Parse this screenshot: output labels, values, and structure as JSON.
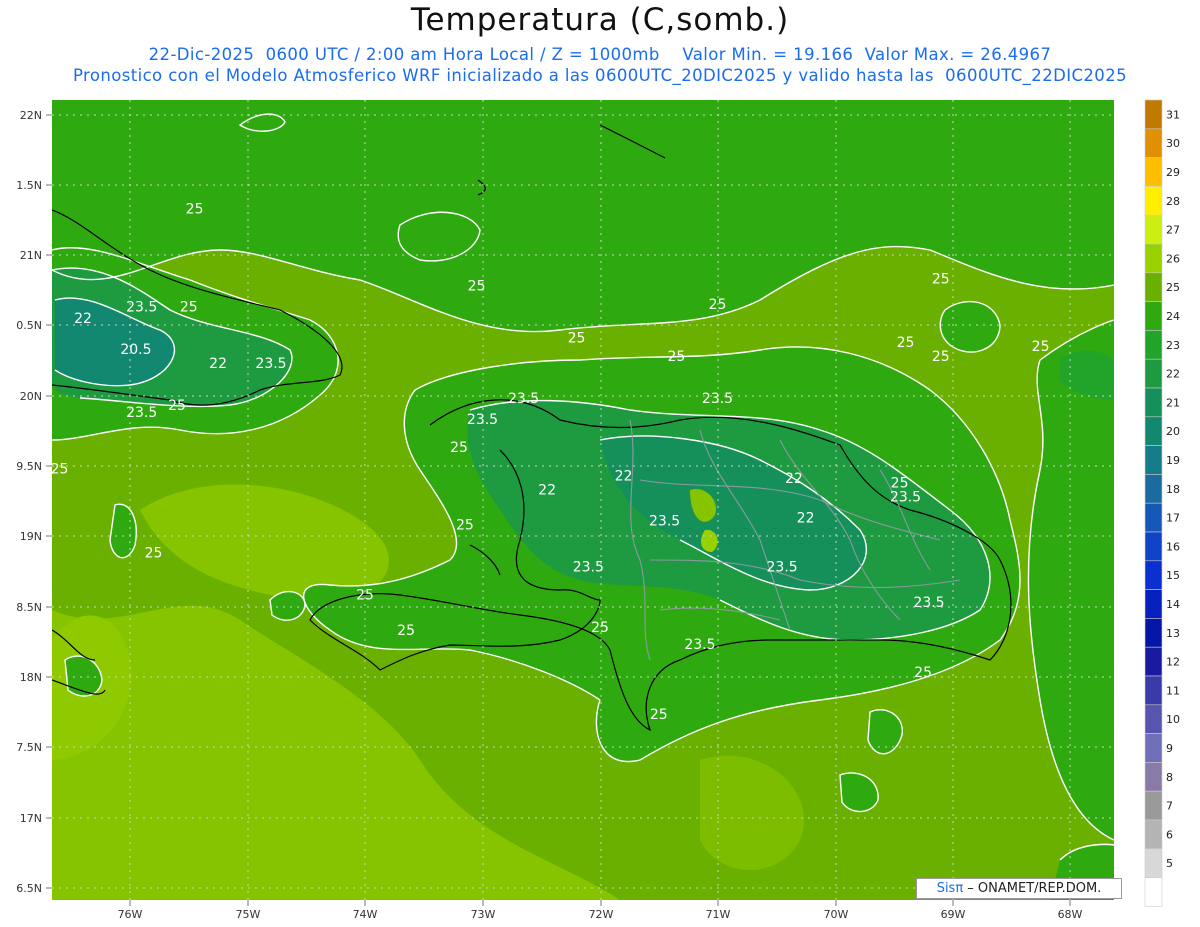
{
  "header": {
    "title": "Temperatura (C,somb.)",
    "line1": "22-Dic-2025  0600 UTC / 2:00 am Hora Local / Z = 1000mb    Valor Min. = 19.166  Valor Max. = 26.4967",
    "line2": "Pronostico con el Modelo Atmosferico WRF inicializado a las 0600UTC_20DIC2025 y valido hasta las  0600UTC_22DIC2025"
  },
  "axes": {
    "lat_labels": [
      "22N",
      "1.5N",
      "21N",
      "0.5N",
      "20N",
      "9.5N",
      "19N",
      "8.5N",
      "18N",
      "7.5N",
      "17N",
      "6.5N"
    ],
    "lon_labels": [
      "76W",
      "75W",
      "74W",
      "73W",
      "72W",
      "71W",
      "70W",
      "69W",
      "68W"
    ]
  },
  "colorbar": {
    "levels": [
      {
        "label": "31",
        "color": "#c07a00"
      },
      {
        "label": "30",
        "color": "#e09000"
      },
      {
        "label": "29",
        "color": "#ffbf00"
      },
      {
        "label": "28",
        "color": "#ffee00"
      },
      {
        "label": "27",
        "color": "#ccee10"
      },
      {
        "label": "26",
        "color": "#99d100"
      },
      {
        "label": "25",
        "color": "#6ab000"
      },
      {
        "label": "24",
        "color": "#2eaa10"
      },
      {
        "label": "23",
        "color": "#22a32a"
      },
      {
        "label": "22",
        "color": "#1e9a40"
      },
      {
        "label": "21",
        "color": "#16905a"
      },
      {
        "label": "20",
        "color": "#138870"
      },
      {
        "label": "19",
        "color": "#157c88"
      },
      {
        "label": "18",
        "color": "#1a6ca0"
      },
      {
        "label": "17",
        "color": "#1558b8"
      },
      {
        "label": "16",
        "color": "#0f44c8"
      },
      {
        "label": "15",
        "color": "#0a30d0"
      },
      {
        "label": "14",
        "color": "#0620c0"
      },
      {
        "label": "13",
        "color": "#0515a8"
      },
      {
        "label": "12",
        "color": "#1a1aa0"
      },
      {
        "label": "11",
        "color": "#3a3aa8"
      },
      {
        "label": "10",
        "color": "#5656b0"
      },
      {
        "label": "9",
        "color": "#7070b8"
      },
      {
        "label": "8",
        "color": "#8a7aa8"
      },
      {
        "label": "7",
        "color": "#9a9a9a"
      },
      {
        "label": "6",
        "color": "#b4b4b4"
      },
      {
        "label": "5",
        "color": "#d8d8d8"
      },
      {
        "label": "",
        "color": "#ffffff"
      }
    ]
  },
  "contour_labels": [
    {
      "text": "25",
      "lon": -75.45,
      "lat": 21.3
    },
    {
      "text": "25",
      "lon": -73.05,
      "lat": 20.75
    },
    {
      "text": "25",
      "lon": -71.0,
      "lat": 20.62
    },
    {
      "text": "25",
      "lon": -69.1,
      "lat": 20.8
    },
    {
      "text": "25",
      "lon": -69.1,
      "lat": 20.25
    },
    {
      "text": "25",
      "lon": -68.25,
      "lat": 20.32
    },
    {
      "text": "25",
      "lon": -69.4,
      "lat": 20.35
    },
    {
      "text": "25",
      "lon": -72.2,
      "lat": 20.38
    },
    {
      "text": "25",
      "lon": -71.35,
      "lat": 20.25
    },
    {
      "text": "25",
      "lon": -75.5,
      "lat": 20.6
    },
    {
      "text": "25",
      "lon": -75.6,
      "lat": 19.9
    },
    {
      "text": "25",
      "lon": -76.6,
      "lat": 19.45
    },
    {
      "text": "25",
      "lon": -73.2,
      "lat": 19.6
    },
    {
      "text": "25",
      "lon": -73.15,
      "lat": 19.05
    },
    {
      "text": "25",
      "lon": -75.8,
      "lat": 18.85
    },
    {
      "text": "25",
      "lon": -74.0,
      "lat": 18.55
    },
    {
      "text": "25",
      "lon": -73.65,
      "lat": 18.3
    },
    {
      "text": "25",
      "lon": -72.0,
      "lat": 18.32
    },
    {
      "text": "25",
      "lon": -69.45,
      "lat": 19.35
    },
    {
      "text": "25",
      "lon": -69.25,
      "lat": 18.0
    },
    {
      "text": "25",
      "lon": -71.5,
      "lat": 17.7
    },
    {
      "text": "23.5",
      "lon": -75.9,
      "lat": 20.6
    },
    {
      "text": "23.5",
      "lon": -74.8,
      "lat": 20.2
    },
    {
      "text": "23.5",
      "lon": -75.9,
      "lat": 19.85
    },
    {
      "text": "23.5",
      "lon": -72.65,
      "lat": 19.95
    },
    {
      "text": "23.5",
      "lon": -73.0,
      "lat": 19.8
    },
    {
      "text": "23.5",
      "lon": -71.0,
      "lat": 19.95
    },
    {
      "text": "23.5",
      "lon": -71.45,
      "lat": 19.08
    },
    {
      "text": "23.5",
      "lon": -72.1,
      "lat": 18.75
    },
    {
      "text": "23.5",
      "lon": -70.45,
      "lat": 18.75
    },
    {
      "text": "23.5",
      "lon": -69.4,
      "lat": 19.25
    },
    {
      "text": "23.5",
      "lon": -69.2,
      "lat": 18.5
    },
    {
      "text": "23.5",
      "lon": -71.15,
      "lat": 18.2
    },
    {
      "text": "22",
      "lon": -76.4,
      "lat": 20.52
    },
    {
      "text": "22",
      "lon": -75.25,
      "lat": 20.2
    },
    {
      "text": "22",
      "lon": -72.45,
      "lat": 19.3
    },
    {
      "text": "22",
      "lon": -71.8,
      "lat": 19.4
    },
    {
      "text": "22",
      "lon": -70.35,
      "lat": 19.38
    },
    {
      "text": "22",
      "lon": -70.25,
      "lat": 19.1
    },
    {
      "text": "20.5",
      "lon": -75.95,
      "lat": 20.3
    }
  ],
  "credit": {
    "brand": "Sisπ",
    "text": " – ONAMET/REP.DOM."
  }
}
